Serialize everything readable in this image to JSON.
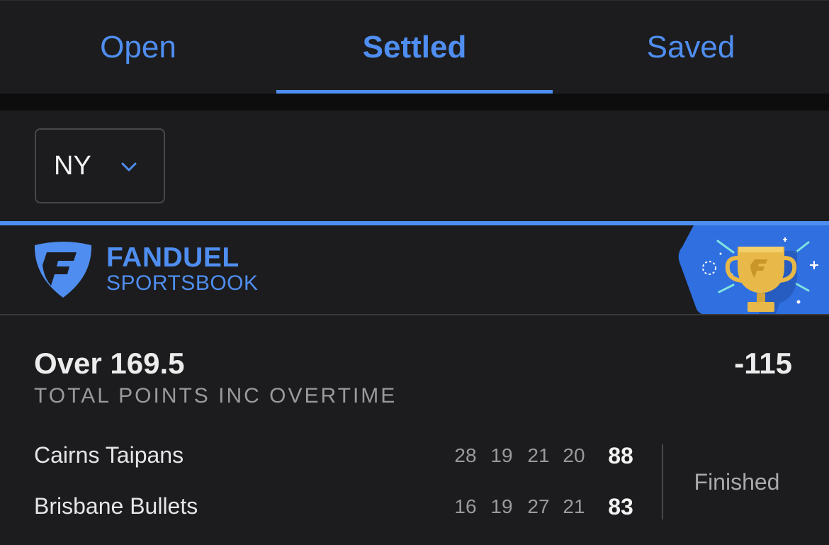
{
  "tabs": [
    {
      "label": "Open",
      "active": false
    },
    {
      "label": "Settled",
      "active": true
    },
    {
      "label": "Saved",
      "active": false
    }
  ],
  "state_selector": {
    "value": "NY",
    "icon": "chevron-down-icon"
  },
  "brand": {
    "name": "FANDUEL",
    "sub": "SPORTSBOOK",
    "badge_icon": "trophy-icon"
  },
  "bet": {
    "selection": "Over 169.5",
    "market": "TOTAL POINTS INC OVERTIME",
    "odds": "-115",
    "status": "Finished",
    "teams": [
      {
        "name": "Cairns Taipans",
        "quarters": [
          "28",
          "19",
          "21",
          "20"
        ],
        "total": "88"
      },
      {
        "name": "Brisbane Bullets",
        "quarters": [
          "16",
          "19",
          "27",
          "21"
        ],
        "total": "83"
      }
    ]
  },
  "colors": {
    "accent": "#4f8ef0",
    "background": "#1c1c1e",
    "badge": "#2f6fe0",
    "trophy": "#e8b948"
  }
}
